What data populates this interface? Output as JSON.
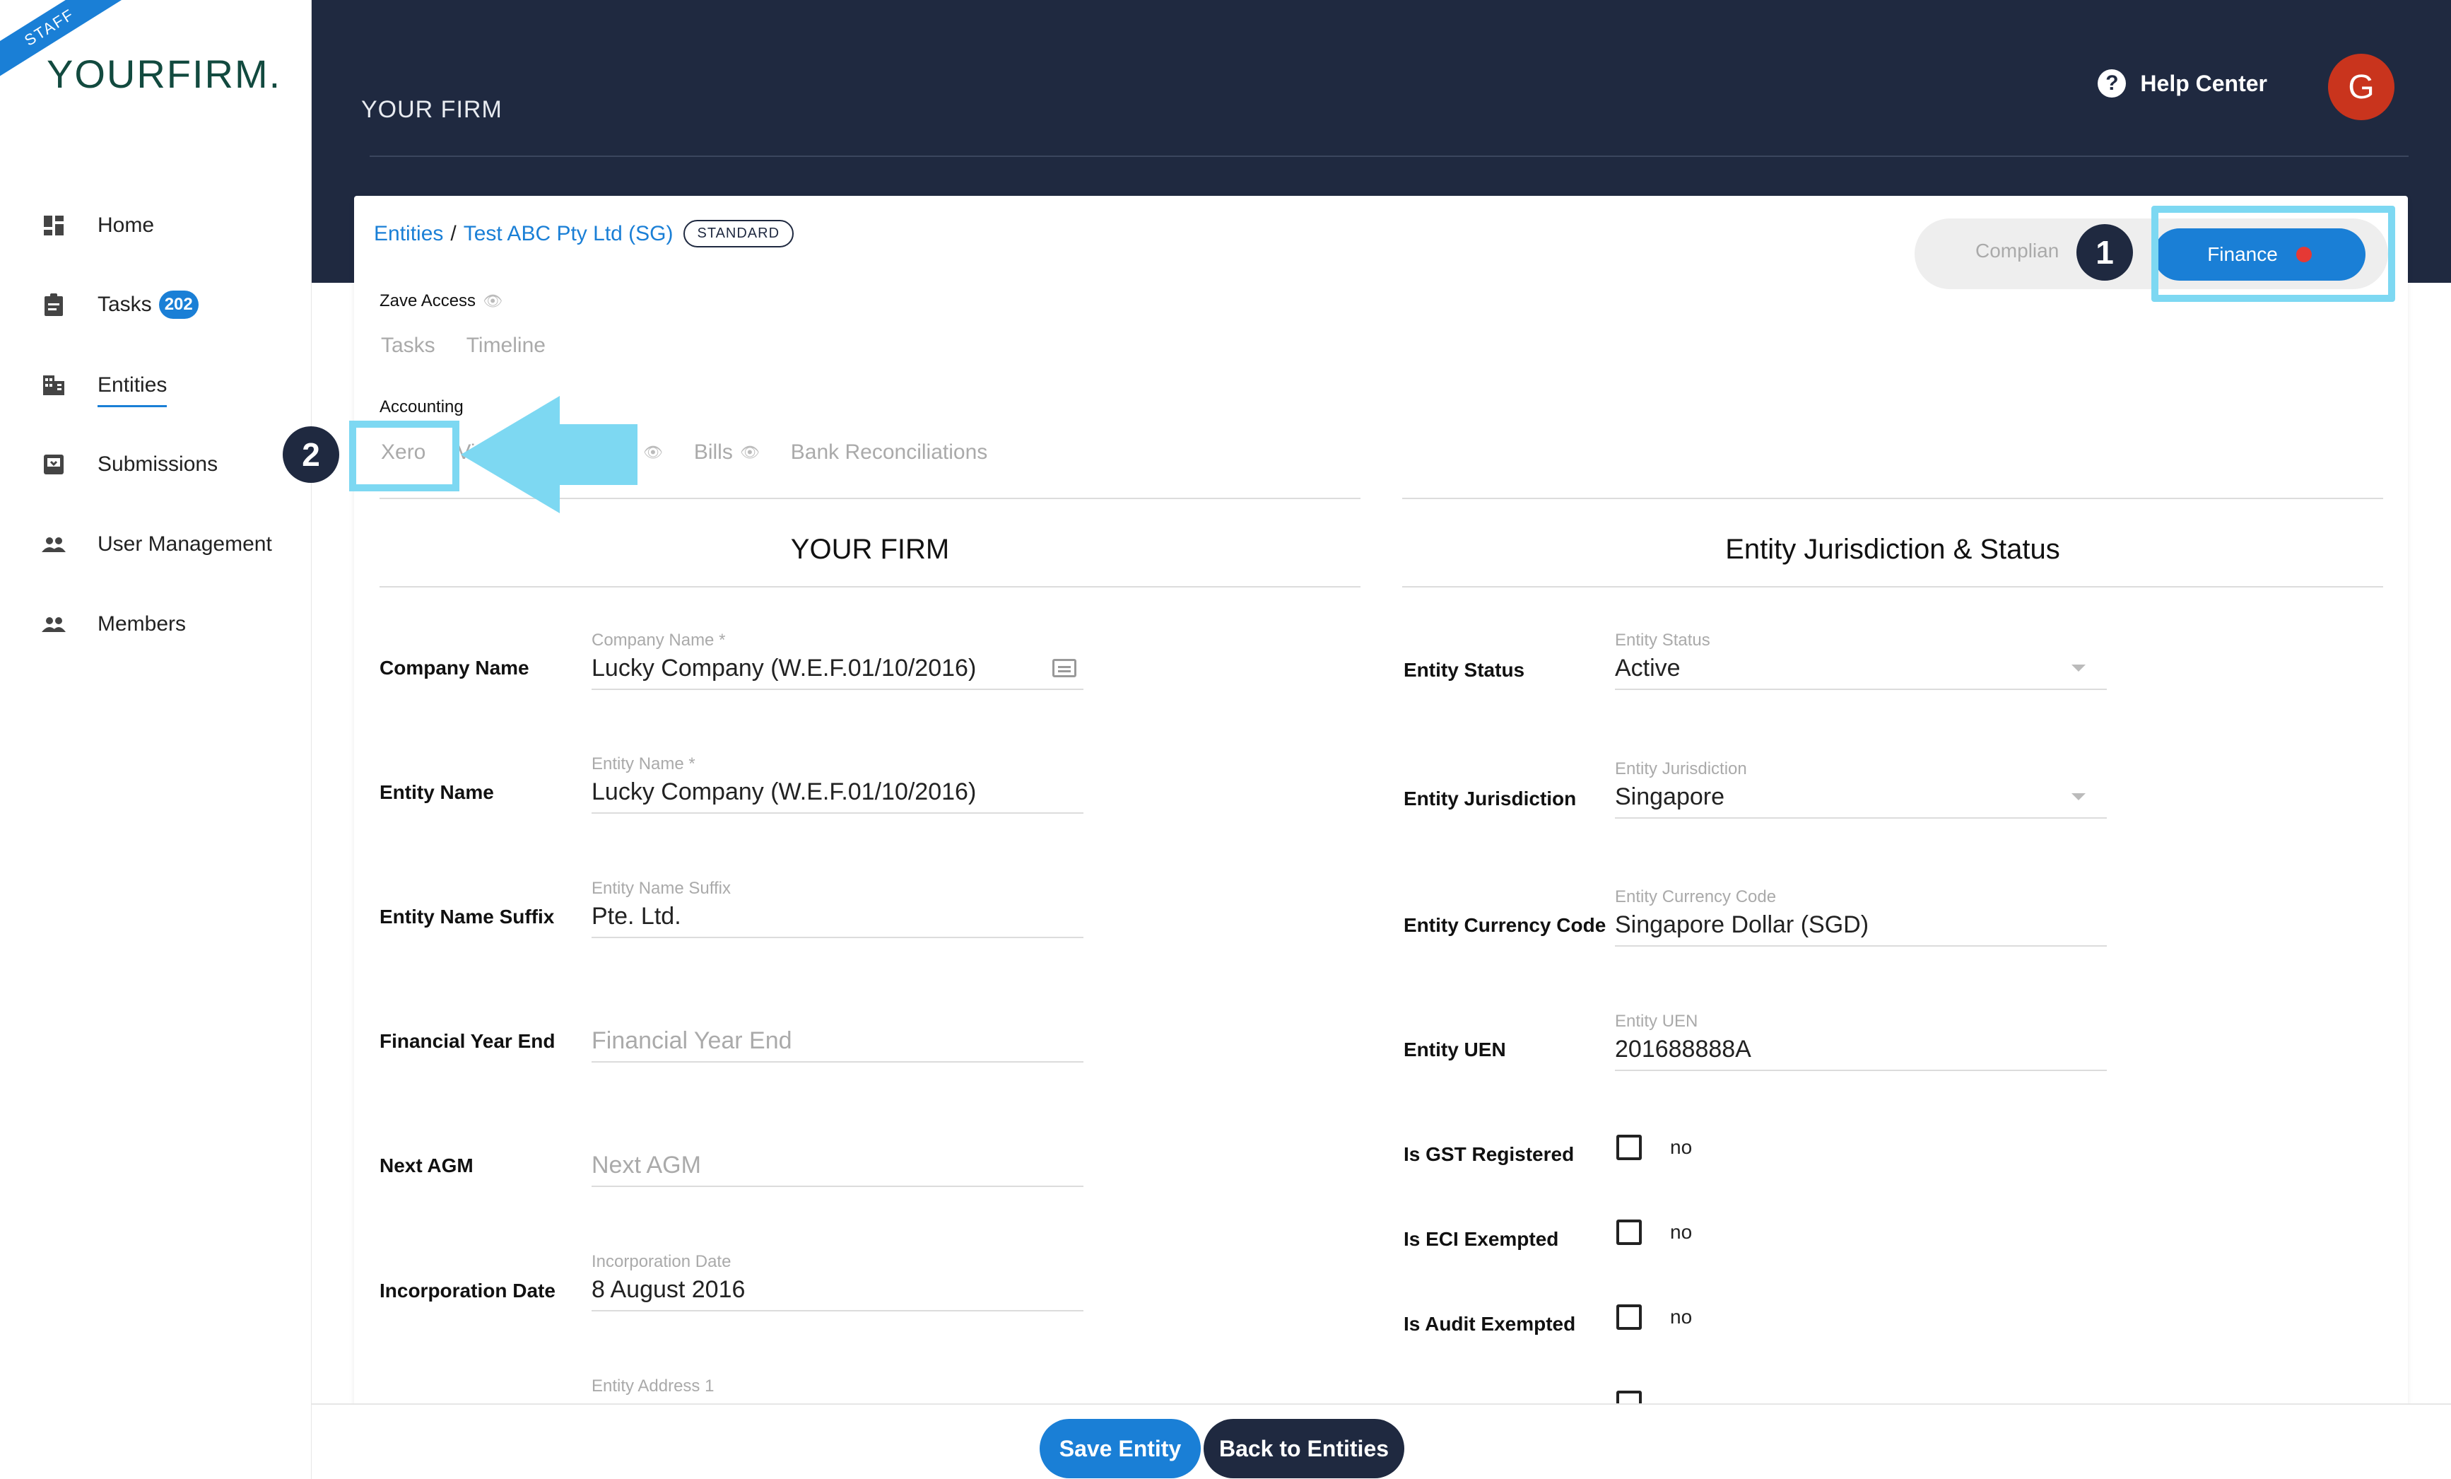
{
  "sidebar": {
    "ribbon": "STAFF",
    "logo_bold": "YOURFIRM",
    "logo_dot": ".",
    "items": [
      {
        "label": "Home",
        "icon": "dashboard-icon"
      },
      {
        "label": "Tasks",
        "icon": "clipboard-icon",
        "badge": "202"
      },
      {
        "label": "Entities",
        "icon": "building-icon"
      },
      {
        "label": "Submissions",
        "icon": "inbox-icon"
      },
      {
        "label": "User Management",
        "icon": "people-icon"
      },
      {
        "label": "Members",
        "icon": "people-icon"
      }
    ]
  },
  "header": {
    "title": "YOUR FIRM",
    "help_label": "Help Center",
    "avatar_initial": "G"
  },
  "breadcrumb": {
    "root": "Entities",
    "separator": "/",
    "current": "Test ABC Pty Ltd (SG)",
    "plan_badge": "STANDARD"
  },
  "mode_toggle": {
    "compliance_label": "Complian",
    "finance_label": "Finance"
  },
  "annotations": {
    "step1": "1",
    "step2": "2"
  },
  "zave": {
    "label": "Zave Access",
    "tabs": [
      "Tasks",
      "Timeline"
    ]
  },
  "accounting": {
    "label": "Accounting",
    "tabs": [
      "Xero",
      "Vi",
      "nses",
      "Bills",
      "Bank Reconciliations"
    ]
  },
  "left_section": {
    "title": "YOUR FIRM",
    "rows": [
      {
        "label": "Company Name",
        "field_label": "Company Name *",
        "value": "Lucky Company   (W.E.F.01/10/2016)"
      },
      {
        "label": "Entity Name",
        "field_label": "Entity Name *",
        "value": "Lucky Company   (W.E.F.01/10/2016)"
      },
      {
        "label": "Entity Name Suffix",
        "field_label": "Entity Name Suffix",
        "value": "Pte. Ltd."
      },
      {
        "label": "Financial Year End",
        "field_label": "",
        "placeholder": "Financial Year End"
      },
      {
        "label": "Next AGM",
        "field_label": "",
        "placeholder": "Next AGM"
      },
      {
        "label": "Incorporation Date",
        "field_label": "Incorporation Date",
        "value": "8 August 2016"
      },
      {
        "label": "",
        "field_label": "Entity Address 1",
        "value": ""
      }
    ]
  },
  "right_section": {
    "title": "Entity Jurisdiction & Status",
    "rows": [
      {
        "label": "Entity Status",
        "field_label": "Entity Status",
        "value": "Active"
      },
      {
        "label": "Entity Jurisdiction",
        "field_label": "Entity Jurisdiction",
        "value": "Singapore"
      },
      {
        "label": "Entity Currency Code",
        "field_label": "Entity Currency Code",
        "value": "Singapore Dollar (SGD)"
      },
      {
        "label": "Entity UEN",
        "field_label": "Entity UEN",
        "value": "201688888A"
      }
    ],
    "checks": [
      {
        "label": "Is GST Registered",
        "value": "no"
      },
      {
        "label": "Is ECI Exempted",
        "value": "no"
      },
      {
        "label": "Is Audit Exempted",
        "value": "no"
      }
    ]
  },
  "footer": {
    "save_label": "Save Entity",
    "back_label": "Back to Entities"
  },
  "colors": {
    "navy": "#1f2940",
    "accent": "#1a7fd6",
    "highlight": "#7dd8f2",
    "alert_dot": "#e53935",
    "avatar": "#c9341d"
  }
}
